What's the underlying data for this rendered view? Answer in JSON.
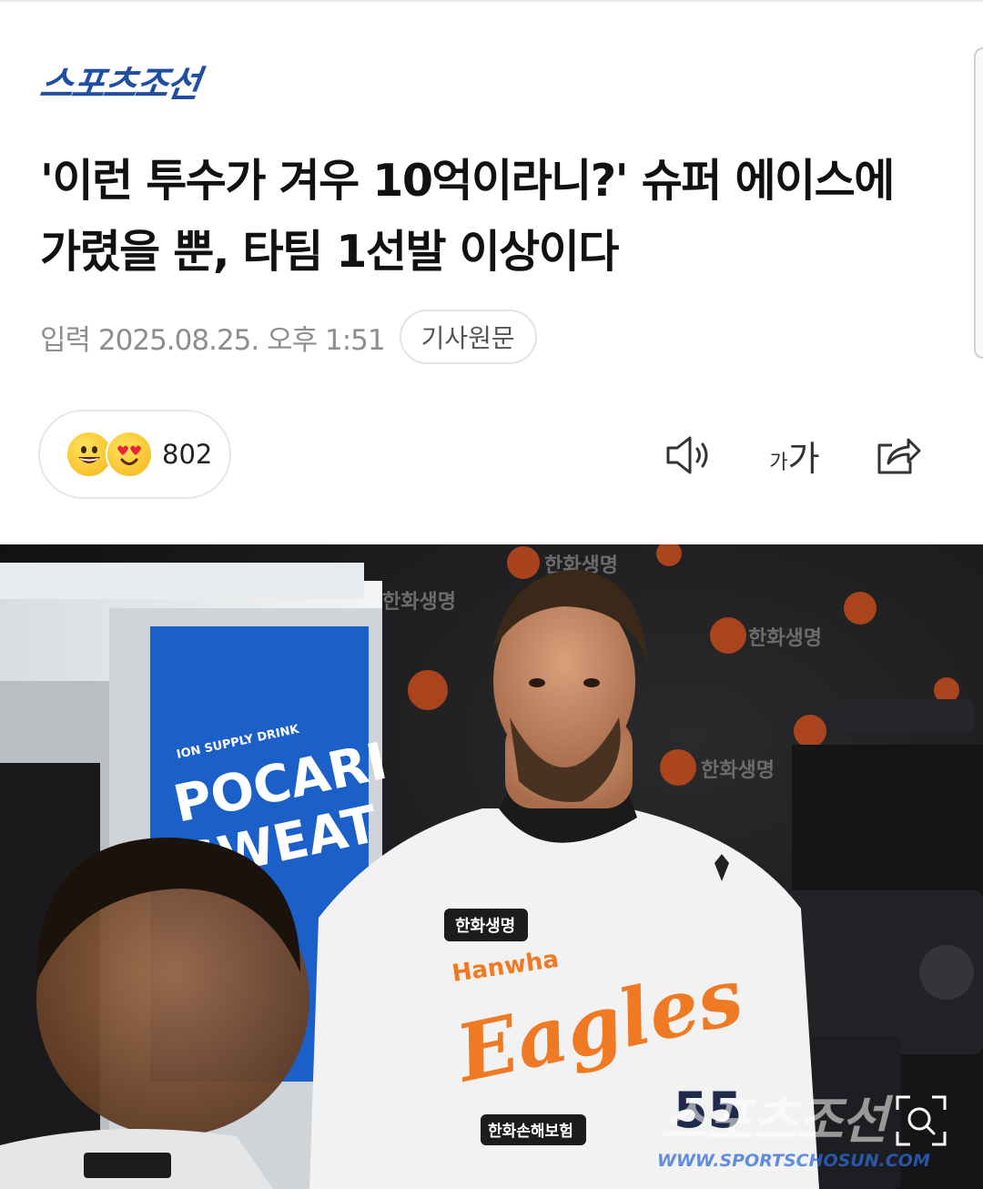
{
  "publisher": {
    "logo_text": "스포츠조선"
  },
  "article": {
    "headline": "'이런 투수가 겨우 10억이라니?' 슈퍼 에이스에 가렸을 뿐, 타팀 1선발 이상이다",
    "published": "입력 2025.08.25. 오후 1:51",
    "source_button": "기사원문"
  },
  "reactions": {
    "emojis": [
      "grin-emoji",
      "heart-eyes-emoji"
    ],
    "count": "802"
  },
  "toolbar": {
    "icons": [
      "speaker-icon",
      "font-size-icon",
      "share-icon"
    ],
    "font_size_small": "가",
    "font_size_large": "가"
  },
  "photo": {
    "cooler_brand": "POCARI",
    "cooler_brand_line2": "SWEAT",
    "cooler_tagline": "ION SUPPLY DRINK",
    "jersey_team": "Eagles",
    "jersey_sponsor": "Hanwha",
    "jersey_patch_top": "한화생명",
    "jersey_patch_bottom": "한화손해보험",
    "jersey_number": "55",
    "backdrop_sponsor": "한화생명",
    "watermark_logo": "스포츠조선",
    "watermark_url": "WWW.SPORTSCHOSUN.COM",
    "zoom_icon": "magnify-icon"
  },
  "colors": {
    "logo_blue": "#1f4ea3",
    "eagles_orange": "#f07a24",
    "pocari_blue": "#1b5fc9"
  }
}
